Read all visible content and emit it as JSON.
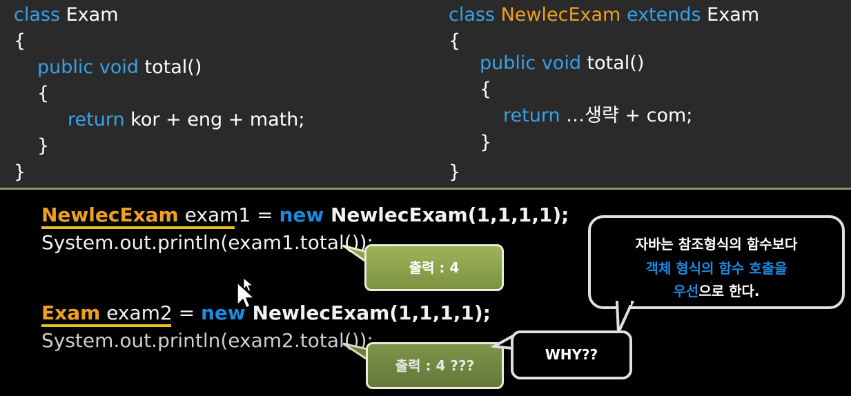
{
  "code_left": {
    "line1_kw": "class",
    "line1_name": " Exam",
    "line2": "{",
    "line3_kw": "public void",
    "line3_rest": " total()",
    "line4": "{",
    "line5_kw": "return",
    "line5_rest": " kor + eng + math;",
    "line6": "}",
    "line7": "}"
  },
  "code_right": {
    "line1_kw": "class",
    "line1_type": " NewlecExam",
    "line1_kw2": " extends",
    "line1_name": " Exam",
    "line2": "{",
    "line3_kw": "public void",
    "line3_rest": " total()",
    "line4": "{",
    "line5_kw": "return",
    "line5_rest": " …생략 + com;",
    "line6": "}",
    "line7": "}"
  },
  "bottom": {
    "l1_type": "NewlecExam",
    "l1_var": " exam1",
    "l1_eq": " = ",
    "l1_new": "new",
    "l1_ctor": " NewlecExam(1,1,1,1);",
    "l2": "System.out.println(exam1.total());",
    "l3_type": "Exam",
    "l3_var": " exam2",
    "l3_eq": " = ",
    "l3_new": "new",
    "l3_ctor": " NewlecExam(1,1,1,1);",
    "l4": "System.out.println(exam2.total());"
  },
  "callouts": {
    "output1": "출력 : 4",
    "output2": "출력 : 4 ???",
    "why": "WHY??",
    "bubble_line1": "자바는 참조형식의 함수보다",
    "bubble_line2": "객체 형식의 함수 호출을",
    "bubble_line3a": "우선",
    "bubble_line3b": "으로 한다."
  },
  "colors": {
    "keyword": "#3aa0e6",
    "type": "#f0a020",
    "green_box": "#8fa34a",
    "divider": "#8a9a5b"
  }
}
